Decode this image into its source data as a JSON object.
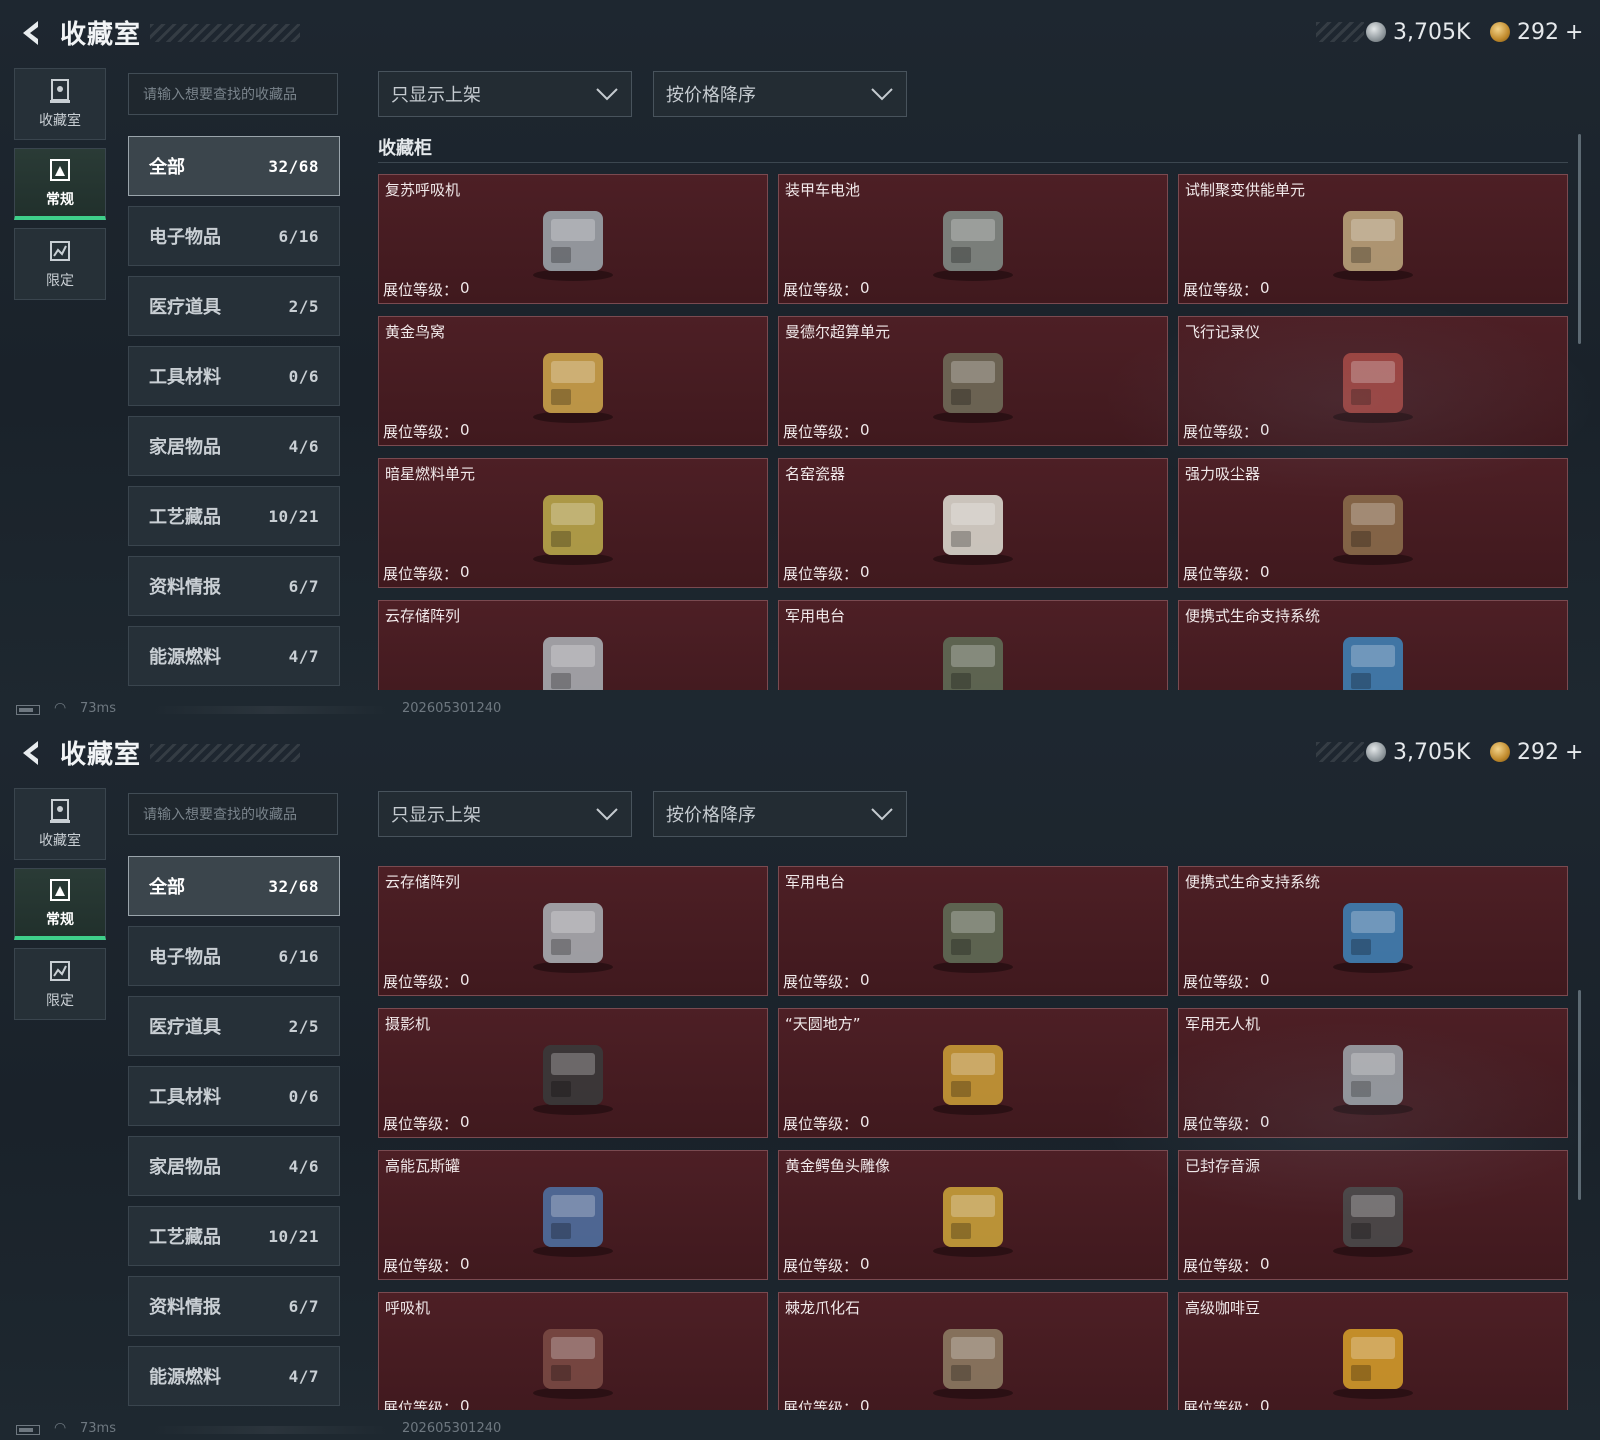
{
  "header": {
    "title": "收藏室"
  },
  "currency": {
    "silver": "3,705K",
    "gold": "292",
    "add_symbol": "+"
  },
  "side_nav": [
    {
      "label": "收藏室",
      "icon": "collection-room-icon"
    },
    {
      "label": "常规",
      "icon": "regular-icon",
      "active": true
    },
    {
      "label": "限定",
      "icon": "limited-icon"
    }
  ],
  "search": {
    "placeholder": "请输入想要查找的收藏品"
  },
  "filter_dropdown": {
    "value": "只显示上架"
  },
  "sort_dropdown": {
    "value": "按价格降序"
  },
  "categories": [
    {
      "label": "全部",
      "count": "32/68",
      "active": true
    },
    {
      "label": "电子物品",
      "count": "6/16"
    },
    {
      "label": "医疗道具",
      "count": "2/5"
    },
    {
      "label": "工具材料",
      "count": "0/6"
    },
    {
      "label": "家居物品",
      "count": "4/6"
    },
    {
      "label": "工艺藏品",
      "count": "10/21"
    },
    {
      "label": "资料情报",
      "count": "6/7"
    },
    {
      "label": "能源燃料",
      "count": "4/7"
    }
  ],
  "section_title": "收藏柜",
  "level_label": "展位等级：",
  "items": [
    {
      "name": "复苏呼吸机",
      "level": "0",
      "icon": "resuscitator-icon"
    },
    {
      "name": "装甲车电池",
      "level": "0",
      "icon": "battery-icon"
    },
    {
      "name": "试制聚变供能单元",
      "level": "0",
      "icon": "fusion-unit-icon"
    },
    {
      "name": "黄金鸟窝",
      "level": "0",
      "icon": "golden-nest-icon"
    },
    {
      "name": "曼德尔超算单元",
      "level": "0",
      "icon": "supercomputer-chip-icon"
    },
    {
      "name": "飞行记录仪",
      "level": "0",
      "icon": "flight-recorder-icon"
    },
    {
      "name": "暗星燃料单元",
      "level": "0",
      "icon": "fuel-cell-icon"
    },
    {
      "name": "名窑瓷器",
      "level": "0",
      "icon": "porcelain-vase-icon"
    },
    {
      "name": "强力吸尘器",
      "level": "0",
      "icon": "vacuum-cleaner-icon"
    },
    {
      "name": "云存储阵列",
      "level": "0",
      "icon": "storage-array-icon"
    },
    {
      "name": "军用电台",
      "level": "0",
      "icon": "military-radio-icon"
    },
    {
      "name": "便携式生命支持系统",
      "level": "0",
      "icon": "life-support-icon"
    },
    {
      "name": "摄影机",
      "level": "0",
      "icon": "video-camera-icon"
    },
    {
      "name": "“天圆地方”",
      "level": "0",
      "icon": "armillary-sphere-icon"
    },
    {
      "name": "军用无人机",
      "level": "0",
      "icon": "drone-icon"
    },
    {
      "name": "高能瓦斯罐",
      "level": "0",
      "icon": "gas-canister-icon"
    },
    {
      "name": "黄金鳄鱼头雕像",
      "level": "0",
      "icon": "gold-crocodile-statue-icon"
    },
    {
      "name": "已封存音源",
      "level": "0",
      "icon": "reel-recorder-icon"
    },
    {
      "name": "呼吸机",
      "level": "0",
      "icon": "ventilator-icon"
    },
    {
      "name": "棘龙爪化石",
      "level": "0",
      "icon": "claw-fossil-icon"
    },
    {
      "name": "高级咖啡豆",
      "level": "0",
      "icon": "coffee-bag-icon"
    }
  ],
  "status": {
    "ping": "73ms",
    "build": "202605301240"
  },
  "colors": {
    "accent": "#3fcf8a",
    "card_bg": "#4a1e24",
    "card_border": "#7a4a50"
  }
}
